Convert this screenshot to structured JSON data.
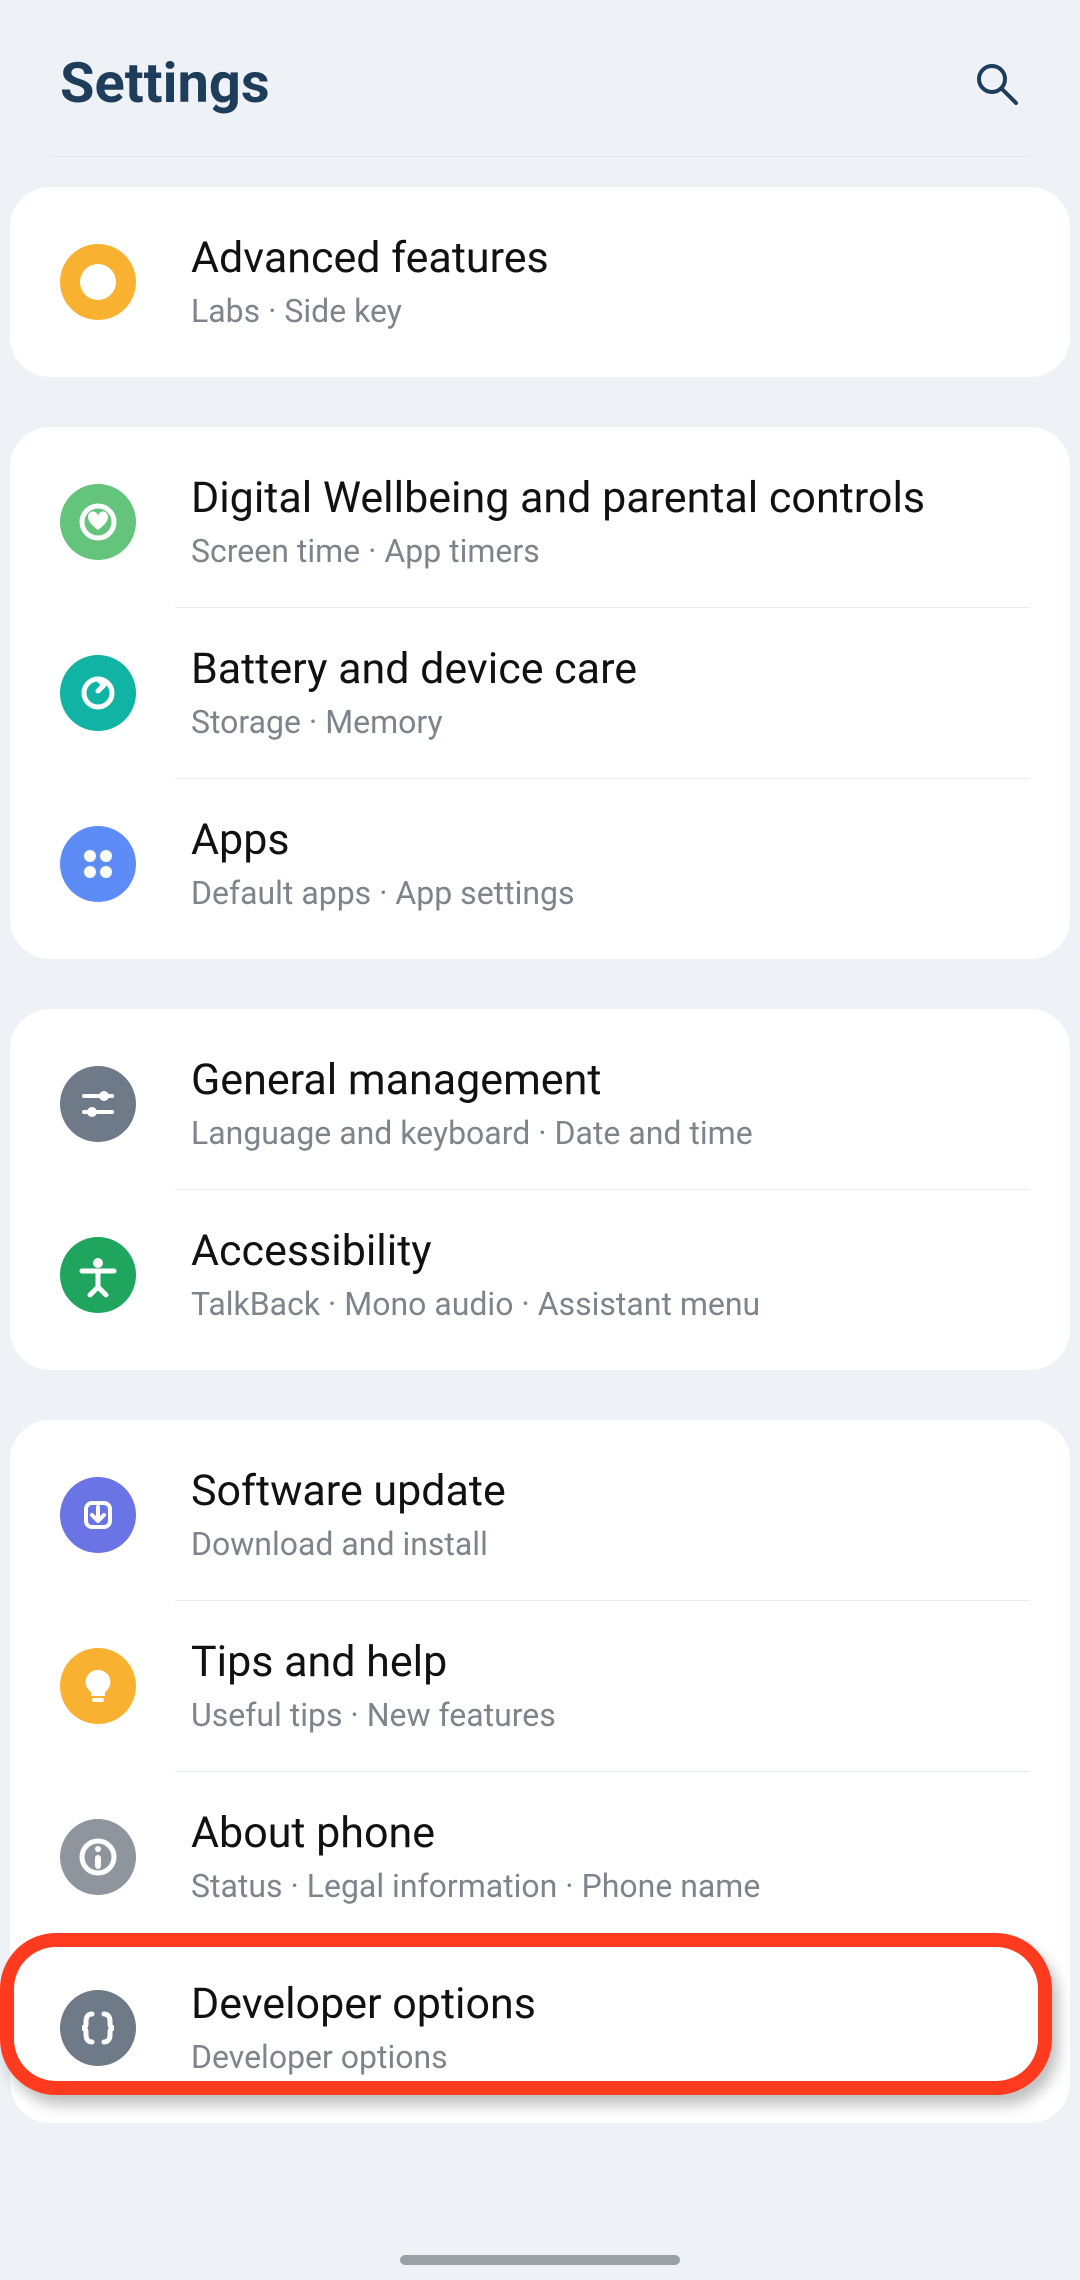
{
  "header": {
    "title": "Settings"
  },
  "groups": [
    {
      "rows": [
        {
          "id": "advanced-features",
          "icon": "plus-badge-icon",
          "color": "c-orange",
          "title": "Advanced features",
          "subtitle": "Labs  ·  Side key"
        }
      ]
    },
    {
      "rows": [
        {
          "id": "digital-wellbeing",
          "icon": "heart-circle-icon",
          "color": "c-green1",
          "title": "Digital Wellbeing and parental controls",
          "subtitle": "Screen time  ·  App timers"
        },
        {
          "id": "battery-device-care",
          "icon": "refresh-circle-icon",
          "color": "c-teal",
          "title": "Battery and device care",
          "subtitle": "Storage  ·  Memory"
        },
        {
          "id": "apps",
          "icon": "grid-dots-icon",
          "color": "c-blue",
          "title": "Apps",
          "subtitle": "Default apps  ·  App settings"
        }
      ]
    },
    {
      "rows": [
        {
          "id": "general-management",
          "icon": "sliders-icon",
          "color": "c-slate",
          "title": "General management",
          "subtitle": "Language and keyboard  ·  Date and time"
        },
        {
          "id": "accessibility",
          "icon": "accessibility-icon",
          "color": "c-green2",
          "title": "Accessibility",
          "subtitle": "TalkBack  ·  Mono audio  ·  Assistant menu"
        }
      ]
    },
    {
      "rows": [
        {
          "id": "software-update",
          "icon": "download-circle-icon",
          "color": "c-indigo",
          "title": "Software update",
          "subtitle": "Download and install"
        },
        {
          "id": "tips-help",
          "icon": "lightbulb-icon",
          "color": "c-orange",
          "title": "Tips and help",
          "subtitle": "Useful tips  ·  New features"
        },
        {
          "id": "about-phone",
          "icon": "info-icon",
          "color": "c-grey",
          "title": "About phone",
          "subtitle": "Status  ·  Legal information  ·  Phone name"
        },
        {
          "id": "developer-options",
          "icon": "braces-icon",
          "color": "c-slate",
          "title": "Developer options",
          "subtitle": "Developer options"
        }
      ]
    }
  ],
  "highlight_target": "developer-options"
}
